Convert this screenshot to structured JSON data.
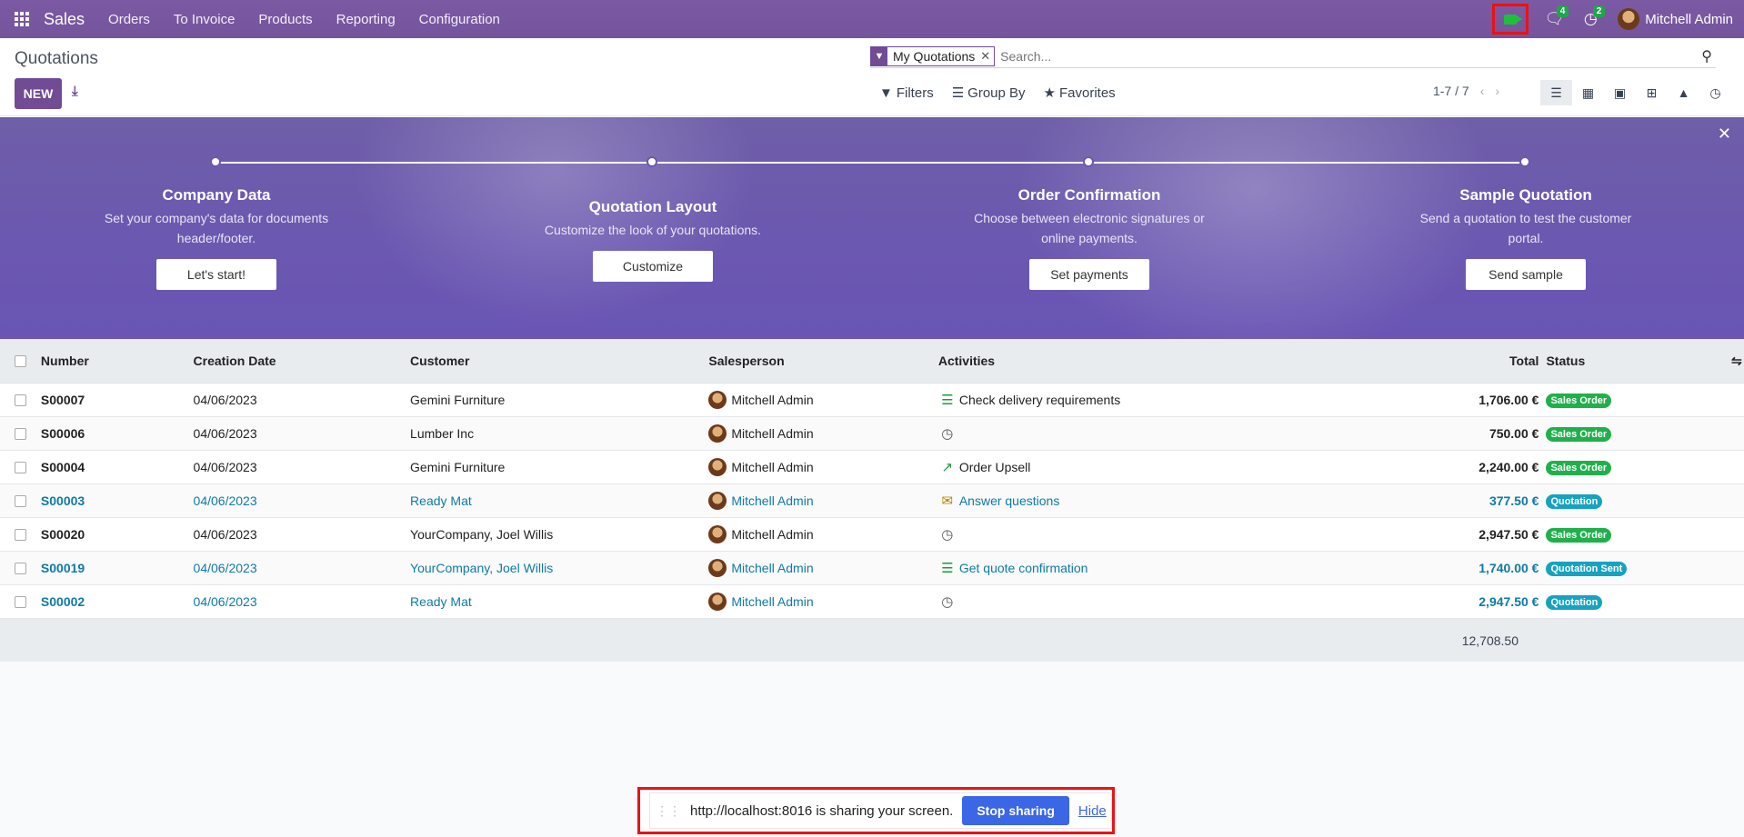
{
  "app": {
    "title": "Sales",
    "user_name": "Mitchell Admin"
  },
  "topnav": {
    "menu": [
      "Orders",
      "To Invoice",
      "Products",
      "Reporting",
      "Configuration"
    ],
    "messages_count": "4",
    "activities_count": "2"
  },
  "control_panel": {
    "breadcrumb": "Quotations",
    "new_label": "NEW",
    "facet_label": "My Quotations",
    "search_placeholder": "Search...",
    "filters_label": "Filters",
    "groupby_label": "Group By",
    "favorites_label": "Favorites",
    "pager": "1-7 / 7"
  },
  "banner": {
    "steps": [
      {
        "title": "Company Data",
        "desc": "Set your company's data for documents header/footer.",
        "button": "Let's start!"
      },
      {
        "title": "Quotation Layout",
        "desc": "Customize the look of your quotations.",
        "button": "Customize"
      },
      {
        "title": "Order Confirmation",
        "desc": "Choose between electronic signatures or online payments.",
        "button": "Set payments"
      },
      {
        "title": "Sample Quotation",
        "desc": "Send a quotation to test the customer portal.",
        "button": "Send sample"
      }
    ]
  },
  "table": {
    "headers": {
      "number": "Number",
      "creation_date": "Creation Date",
      "customer": "Customer",
      "salesperson": "Salesperson",
      "activities": "Activities",
      "total": "Total",
      "status": "Status"
    },
    "rows": [
      {
        "number": "S00007",
        "date": "04/06/2023",
        "customer": "Gemini Furniture",
        "salesperson": "Mitchell Admin",
        "activity": "Check delivery requirements",
        "activity_icon": "tasks-icon",
        "total": "1,706.00 €",
        "status": "Sales Order"
      },
      {
        "number": "S00006",
        "date": "04/06/2023",
        "customer": "Lumber Inc",
        "salesperson": "Mitchell Admin",
        "activity": "",
        "activity_icon": "clock-icon",
        "total": "750.00 €",
        "status": "Sales Order"
      },
      {
        "number": "S00004",
        "date": "04/06/2023",
        "customer": "Gemini Furniture",
        "salesperson": "Mitchell Admin",
        "activity": "Order Upsell",
        "activity_icon": "chart-line-icon",
        "total": "2,240.00 €",
        "status": "Sales Order"
      },
      {
        "number": "S00003",
        "date": "04/06/2023",
        "customer": "Ready Mat",
        "salesperson": "Mitchell Admin",
        "activity": "Answer questions",
        "activity_icon": "envelope-icon",
        "total": "377.50 €",
        "status": "Quotation"
      },
      {
        "number": "S00020",
        "date": "04/06/2023",
        "customer": "YourCompany, Joel Willis",
        "salesperson": "Mitchell Admin",
        "activity": "",
        "activity_icon": "clock-icon",
        "total": "2,947.50 €",
        "status": "Sales Order"
      },
      {
        "number": "S00019",
        "date": "04/06/2023",
        "customer": "YourCompany, Joel Willis",
        "salesperson": "Mitchell Admin",
        "activity": "Get quote confirmation",
        "activity_icon": "tasks-icon",
        "total": "1,740.00 €",
        "status": "Quotation Sent"
      },
      {
        "number": "S00002",
        "date": "04/06/2023",
        "customer": "Ready Mat",
        "salesperson": "Mitchell Admin",
        "activity": "",
        "activity_icon": "clock-icon",
        "total": "2,947.50 €",
        "status": "Quotation"
      }
    ],
    "grand_total": "12,708.50"
  },
  "sharebar": {
    "text": "http://localhost:8016 is sharing your screen.",
    "stop_label": "Stop sharing",
    "hide_label": "Hide"
  },
  "colors": {
    "brand": "#714b94",
    "sales_order_badge": "#20b04b",
    "quotation_badge": "#17a2c0",
    "draft_link": "#0e7aa6"
  }
}
